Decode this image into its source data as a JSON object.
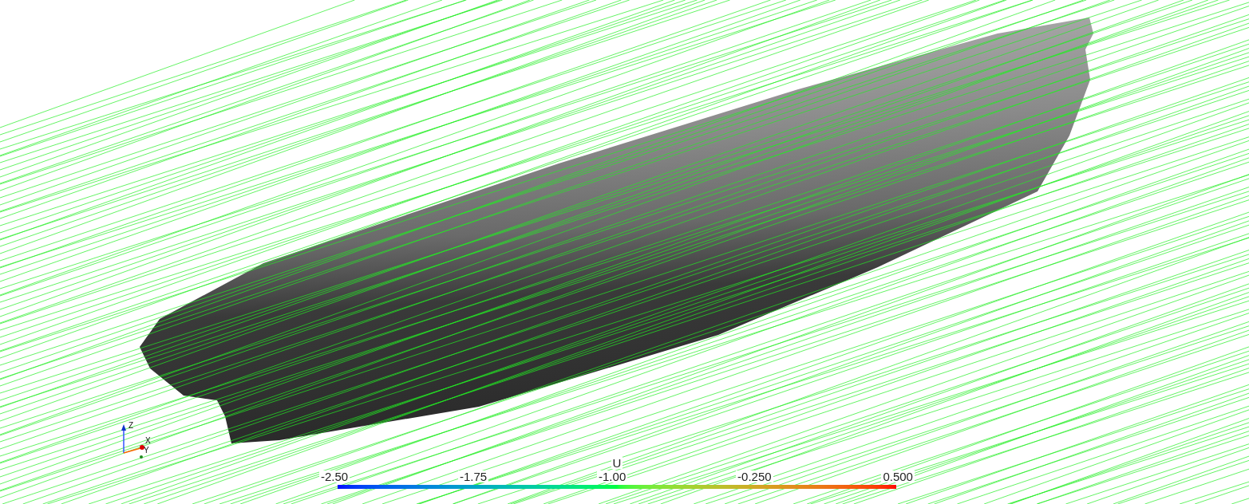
{
  "viewport": {
    "axes": {
      "labels": [
        "Z",
        "X",
        "Y"
      ]
    },
    "legend": {
      "title": "U",
      "labels": [
        "-2.50",
        "-1.75",
        "-1.00",
        "-0.250",
        "0.500"
      ]
    }
  }
}
